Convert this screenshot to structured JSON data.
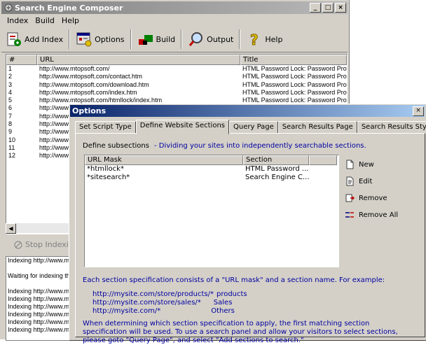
{
  "main": {
    "title": "Search Engine Composer",
    "menu": [
      "Index",
      "Build",
      "Help"
    ],
    "toolbar": {
      "add_index": "Add Index",
      "options": "Options",
      "build": "Build",
      "output": "Output",
      "help": "Help"
    },
    "list_headers": [
      "#",
      "URL",
      "Title"
    ],
    "rows": [
      {
        "n": "1",
        "url": "http://www.mtopsoft.com/",
        "title": "HTML Password Lock: Password Protec"
      },
      {
        "n": "2",
        "url": "http://www.mtopsoft.com/contact.htm",
        "title": "HTML Password Lock: Password Protec"
      },
      {
        "n": "3",
        "url": "http://www.mtopsoft.com/download.htm",
        "title": "HTML Password Lock: Password Protec"
      },
      {
        "n": "4",
        "url": "http://www.mtopsoft.com/index.htm",
        "title": "HTML Password Lock: Password Protec"
      },
      {
        "n": "5",
        "url": "http://www.mtopsoft.com/htmllock/index.htm",
        "title": "HTML Password Lock: Password Protec"
      },
      {
        "n": "6",
        "url": "http://www.mt",
        "title": ""
      },
      {
        "n": "7",
        "url": "http://www.mt",
        "title": ""
      },
      {
        "n": "8",
        "url": "http://www.mt",
        "title": ""
      },
      {
        "n": "9",
        "url": "http://www.mt",
        "title": ""
      },
      {
        "n": "10",
        "url": "http://www.mt",
        "title": ""
      },
      {
        "n": "11",
        "url": "http://www.mt",
        "title": ""
      },
      {
        "n": "12",
        "url": "http://www.mt",
        "title": ""
      }
    ],
    "stop_label": "Stop Indexin",
    "log": [
      "Indexing http://www.m",
      "",
      "Waiting for indexing thr",
      "",
      "Indexing http://www.m",
      "Indexing http://www.m",
      "Indexing http://www.m",
      "Indexing http://www.m",
      "Indexing http://www.m",
      "Indexing http://www.m"
    ]
  },
  "dialog": {
    "title": "Options",
    "tabs": [
      "Set Script Type",
      "Define Website Sections",
      "Query Page",
      "Search Results Page",
      "Search Results Style"
    ],
    "active_tab": 1,
    "define_label": "Define subsections",
    "define_desc": "- Dividing your sites into independently searchable sections.",
    "table_headers": [
      "URL Mask",
      "Section"
    ],
    "sections": [
      {
        "mask": "*htmllock*",
        "section": "HTML Password ..."
      },
      {
        "mask": "*sitesearch*",
        "section": "Search Engine C..."
      }
    ],
    "buttons": {
      "new": "New",
      "edit": "Edit",
      "remove": "Remove",
      "remove_all": "Remove All"
    },
    "help1": "Each section specification consists of a \"URL mask\" and a section name. For example:",
    "examples": [
      {
        "mask": "http://mysite.com/store/products/*",
        "name": "products"
      },
      {
        "mask": "http://mysite.com/store/sales/*",
        "name": "Sales"
      },
      {
        "mask": "http://mysite.com/*",
        "name": "Others"
      }
    ],
    "help2": "When determining which section specification to apply, the first matching section specification will be used. To use a search panel and allow your visitors to select sections, please goto \"Query Page\", and select \"Add sections to search.\""
  }
}
